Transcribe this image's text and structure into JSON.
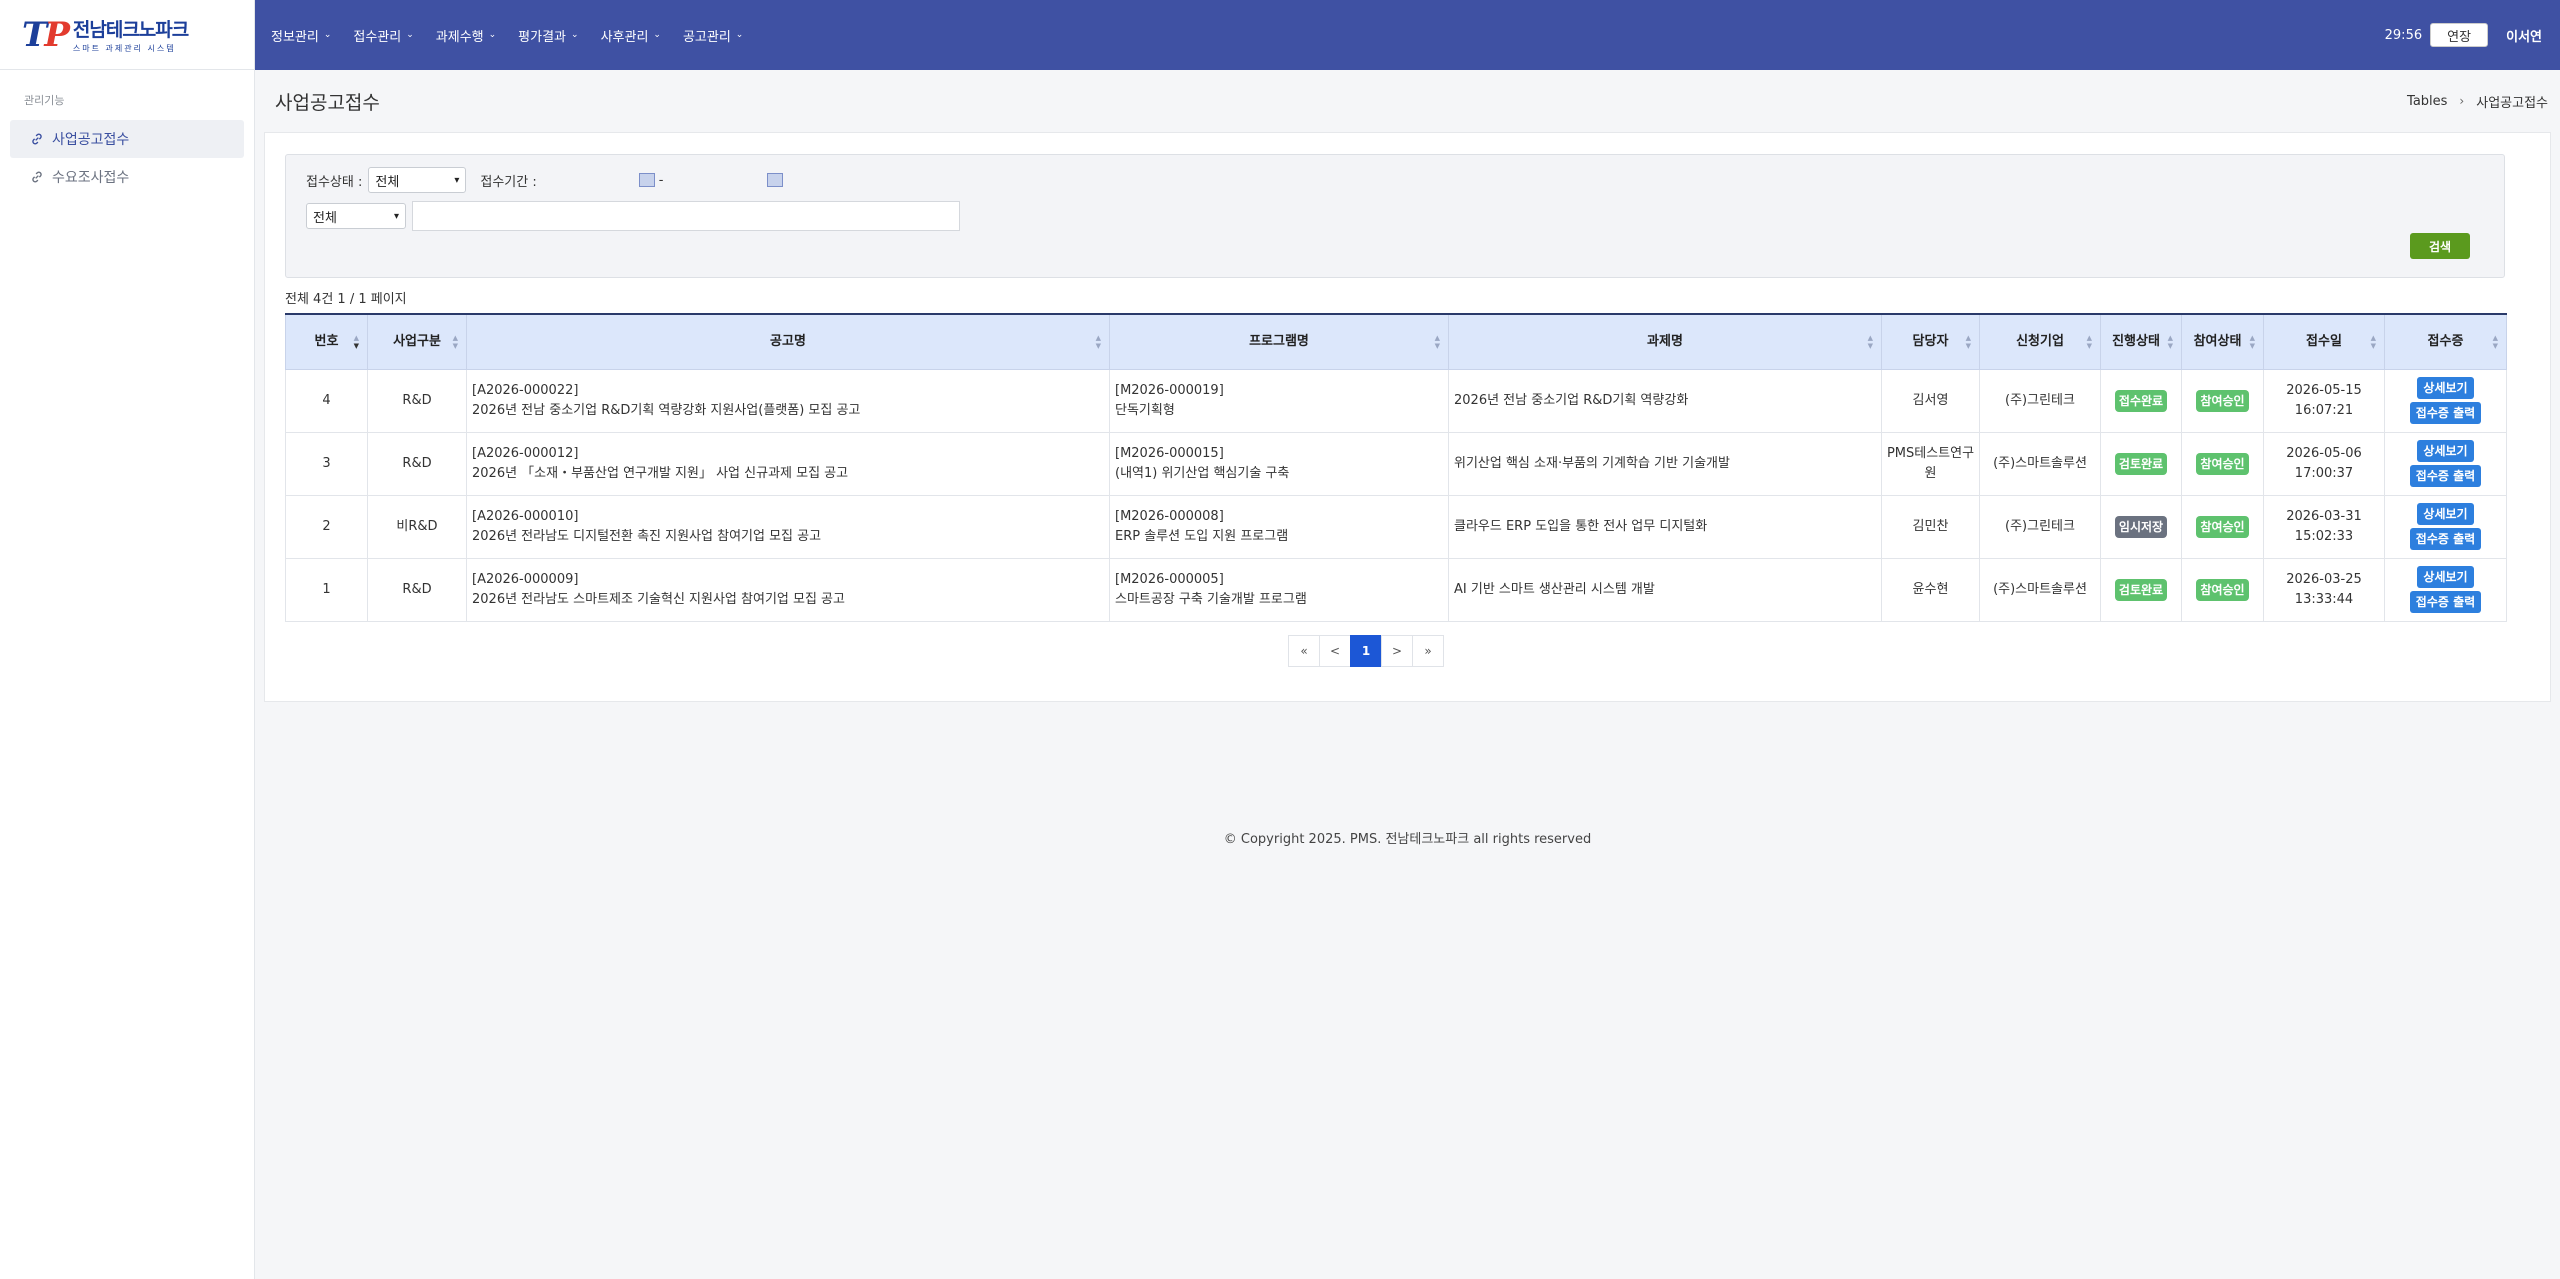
{
  "brand": {
    "mark_t": "T",
    "mark_p": "P",
    "name": "전남테크노파크",
    "subtitle": "스마트 과제관리 시스템"
  },
  "sidebar": {
    "section": "관리기능",
    "items": [
      {
        "label": "사업공고접수",
        "icon": "link-icon",
        "active": true
      },
      {
        "label": "수요조사접수",
        "icon": "link-icon",
        "active": false
      }
    ]
  },
  "topnav": {
    "menus": [
      "정보관리",
      "접수관리",
      "과제수행",
      "평가결과",
      "사후관리",
      "공고관리"
    ],
    "timer": "29:56",
    "extend_label": "연장",
    "user": "이서연"
  },
  "page": {
    "title": "사업공고접수",
    "breadcrumb": [
      "Tables",
      "사업공고접수"
    ]
  },
  "search": {
    "status_label": "접수상태 :",
    "status_value": "전체",
    "period_label": "접수기간 :",
    "period_sep": "-",
    "field_value": "전체",
    "keyword_value": "",
    "button_label": "검색"
  },
  "summary": "전체 4건 1 / 1 페이지",
  "table": {
    "headers": [
      "번호",
      "사업구분",
      "공고명",
      "프로그램명",
      "과제명",
      "담당자",
      "신청기업",
      "진행상태",
      "참여상태",
      "접수일",
      "접수증"
    ],
    "rows": [
      {
        "no": "4",
        "type": "R&D",
        "notice_code": "[A2026-000022]",
        "notice_title": "2026년 전남 중소기업 R&D기획 역량강화 지원사업(플랫폼) 모집 공고",
        "program_code": "[M2026-000019]",
        "program_name": "단독기획형",
        "task": "2026년 전남 중소기업 R&D기획 역량강화",
        "manager": "김서영",
        "company": "(주)그린테크",
        "progress": "접수완료",
        "participation": "참여승인",
        "date": "2026-05-15",
        "time": "16:07:21",
        "detail_btn": "상세보기",
        "print_btn": "접수증 출력"
      },
      {
        "no": "3",
        "type": "R&D",
        "notice_code": "[A2026-000012]",
        "notice_title": "2026년 「소재・부품산업 연구개발 지원」 사업 신규과제 모집 공고",
        "program_code": "[M2026-000015]",
        "program_name": "(내역1) 위기산업 핵심기술 구축",
        "task": "위기산업 핵심 소재·부품의 기계학습 기반 기술개발",
        "manager": "PMS테스트연구원",
        "company": "(주)스마트솔루션",
        "progress": "검토완료",
        "participation": "참여승인",
        "date": "2026-05-06",
        "time": "17:00:37",
        "detail_btn": "상세보기",
        "print_btn": "접수증 출력"
      },
      {
        "no": "2",
        "type": "비R&D",
        "notice_code": "[A2026-000010]",
        "notice_title": "2026년 전라남도 디지털전환 촉진 지원사업 참여기업 모집 공고",
        "program_code": "[M2026-000008]",
        "program_name": "ERP 솔루션 도입 지원 프로그램",
        "task": "클라우드 ERP 도입을 통한 전사 업무 디지털화",
        "manager": "김민찬",
        "company": "(주)그린테크",
        "progress": "임시저장",
        "participation": "참여승인",
        "date": "2026-03-31",
        "time": "15:02:33",
        "detail_btn": "상세보기",
        "print_btn": "접수증 출력"
      },
      {
        "no": "1",
        "type": "R&D",
        "notice_code": "[A2026-000009]",
        "notice_title": "2026년 전라남도 스마트제조 기술혁신 지원사업 참여기업 모집 공고",
        "program_code": "[M2026-000005]",
        "program_name": "스마트공장 구축 기술개발 프로그램",
        "task": "AI 기반 스마트 생산관리 시스템 개발",
        "manager": "윤수현",
        "company": "(주)스마트솔루션",
        "progress": "검토완료",
        "participation": "참여승인",
        "date": "2026-03-25",
        "time": "13:33:44",
        "detail_btn": "상세보기",
        "print_btn": "접수증 출력"
      }
    ]
  },
  "pagination": [
    "«",
    "<",
    "1",
    ">",
    "»"
  ],
  "footer": "© Copyright 2025. PMS. 전남테크노파크 all rights reserved"
}
